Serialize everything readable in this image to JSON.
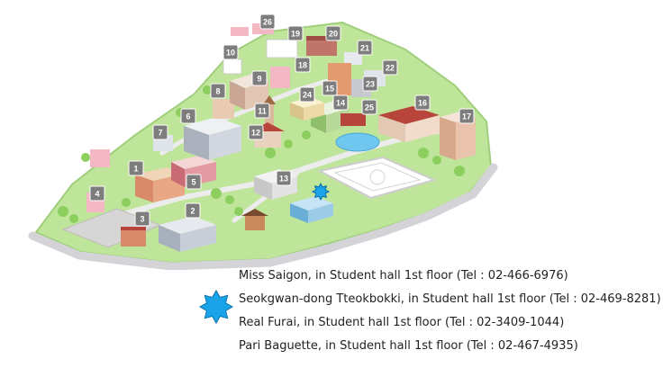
{
  "map": {
    "building_labels": [
      "1",
      "2",
      "3",
      "4",
      "5",
      "6",
      "7",
      "8",
      "9",
      "10",
      "11",
      "12",
      "13",
      "14",
      "15",
      "16",
      "17",
      "18",
      "19",
      "20",
      "21",
      "22",
      "23",
      "24",
      "25",
      "26"
    ],
    "marker": {
      "icon": "star-burst-icon",
      "color": "#1aa3e8",
      "location_building": "13"
    },
    "colors": {
      "grass": "#bfe59a",
      "road": "#d3d3d8",
      "label_box": "#7d7d7d",
      "brick": "#d98a6a",
      "roof_red": "#b8453c",
      "pond": "#6fc6ef"
    }
  },
  "legend": {
    "icon": "star-burst-icon",
    "entries": [
      "Miss Saigon, in Student hall 1st floor (Tel : 02-466-6976)",
      "Seokgwan-dong Tteokbokki, in Student hall 1st floor (Tel : 02-469-8281)",
      "Real Furai, in Student hall 1st floor (Tel : 02-3409-1044)",
      "Pari Baguette, in Student hall 1st floor (Tel : 02-467-4935)"
    ]
  }
}
